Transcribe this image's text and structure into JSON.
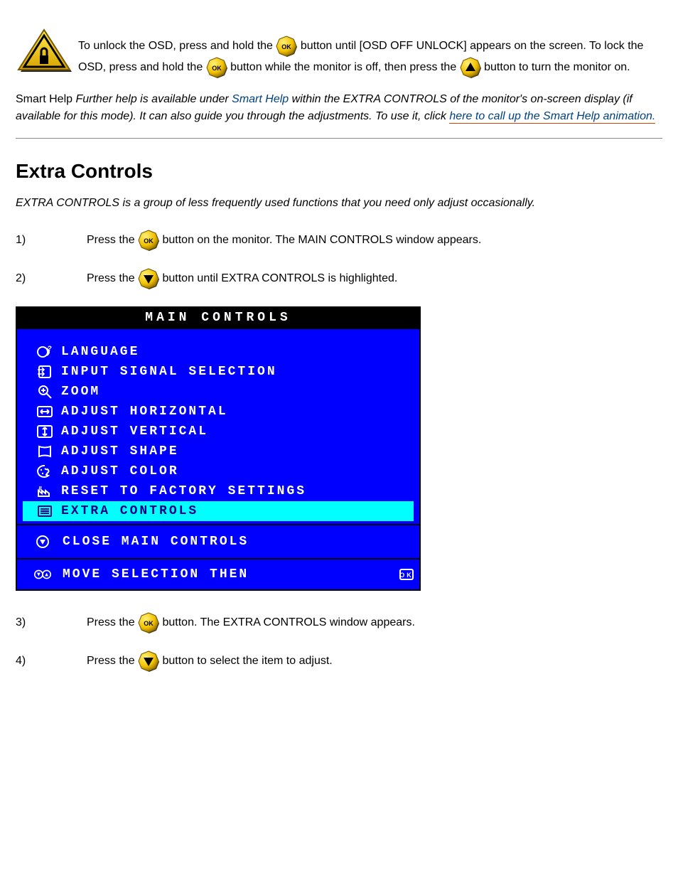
{
  "top": {
    "part1": "To unlock the OSD, press and hold the ",
    "part2": " button until [OSD OFF UNLOCK] appears on the screen. To lock the OSD, press and hold the ",
    "part3": " button while the monitor is off, then press the ",
    "part4": " button to turn the monitor on."
  },
  "smart_help": {
    "prefix": "Smart Help ",
    "italic_part": "Further help is available under ",
    "minor": "within the EXTRA CONTROLS of the monitor's on-screen display (if available for this mode). It can also guide you through the adjustments. To use it, click ",
    "link_text": "here to call up the Smart Help animation."
  },
  "section": {
    "heading": "Extra Controls",
    "lead": "EXTRA CONTROLS is a group of less frequently used functions that you need only adjust occasionally."
  },
  "steps": [
    {
      "num": "1)",
      "before": "Press the ",
      "after": " button on the monitor. The MAIN CONTROLS window appears."
    },
    {
      "num": "2)",
      "before": "Press the ",
      "after": " button until EXTRA CONTROLS is highlighted."
    }
  ],
  "osd": {
    "title": "MAIN CONTROLS",
    "items": [
      {
        "label": "LANGUAGE",
        "icon": "language-icon",
        "highlight": false
      },
      {
        "label": "INPUT SIGNAL SELECTION",
        "icon": "input-icon",
        "highlight": false
      },
      {
        "label": "ZOOM",
        "icon": "zoom-icon",
        "highlight": false
      },
      {
        "label": "ADJUST HORIZONTAL",
        "icon": "horiz-icon",
        "highlight": false
      },
      {
        "label": "ADJUST VERTICAL",
        "icon": "vert-icon",
        "highlight": false
      },
      {
        "label": "ADJUST SHAPE",
        "icon": "shape-icon",
        "highlight": false
      },
      {
        "label": "ADJUST COLOR",
        "icon": "color-icon",
        "highlight": false
      },
      {
        "label": "RESET TO FACTORY SETTINGS",
        "icon": "reset-icon",
        "highlight": false
      },
      {
        "label": "EXTRA CONTROLS",
        "icon": "extra-icon",
        "highlight": true
      }
    ],
    "close_label": "CLOSE MAIN CONTROLS",
    "footer_label": "MOVE SELECTION THEN"
  },
  "steps2": [
    {
      "num": "3)",
      "before": "Press the ",
      "after": " button. The EXTRA CONTROLS window appears."
    },
    {
      "num": "4)",
      "before": "Press the ",
      "after": " button to select the item to adjust."
    }
  ]
}
